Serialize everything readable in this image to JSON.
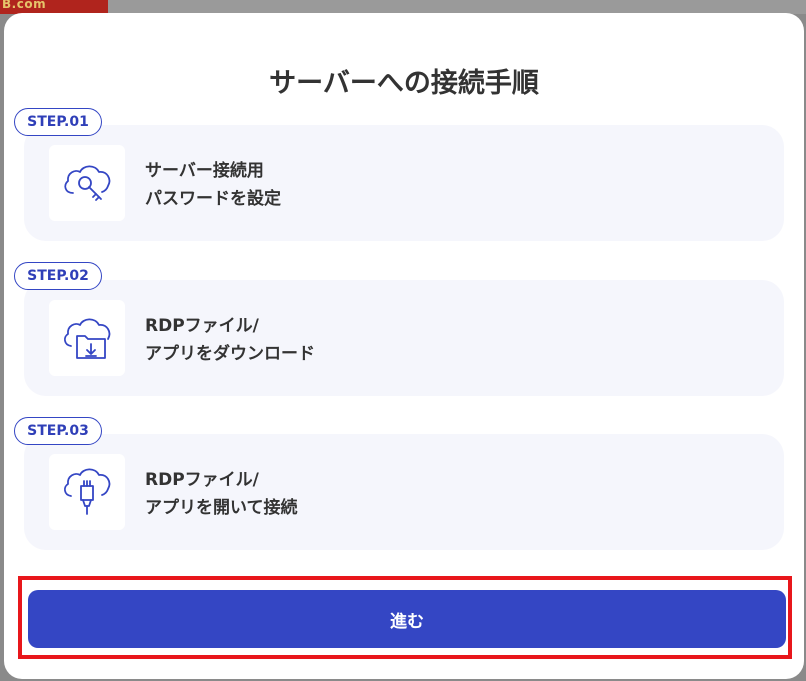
{
  "background": {
    "logo_text": "B.com"
  },
  "modal": {
    "title": "サーバーへの接続手順",
    "steps": [
      {
        "badge": "STEP.01",
        "line1": "サーバー接続用",
        "line2": "パスワードを設定",
        "icon": "cloud-key-icon"
      },
      {
        "badge": "STEP.02",
        "line1": "RDPファイル/",
        "line2": "アプリをダウンロード",
        "icon": "cloud-folder-download-icon"
      },
      {
        "badge": "STEP.03",
        "line1": "RDPファイル/",
        "line2": "アプリを開いて接続",
        "icon": "cloud-connector-icon"
      }
    ],
    "proceed_label": "進む"
  },
  "colors": {
    "accent": "#3446c4",
    "highlight": "#e8161b",
    "step_bg": "#f5f6fc"
  }
}
